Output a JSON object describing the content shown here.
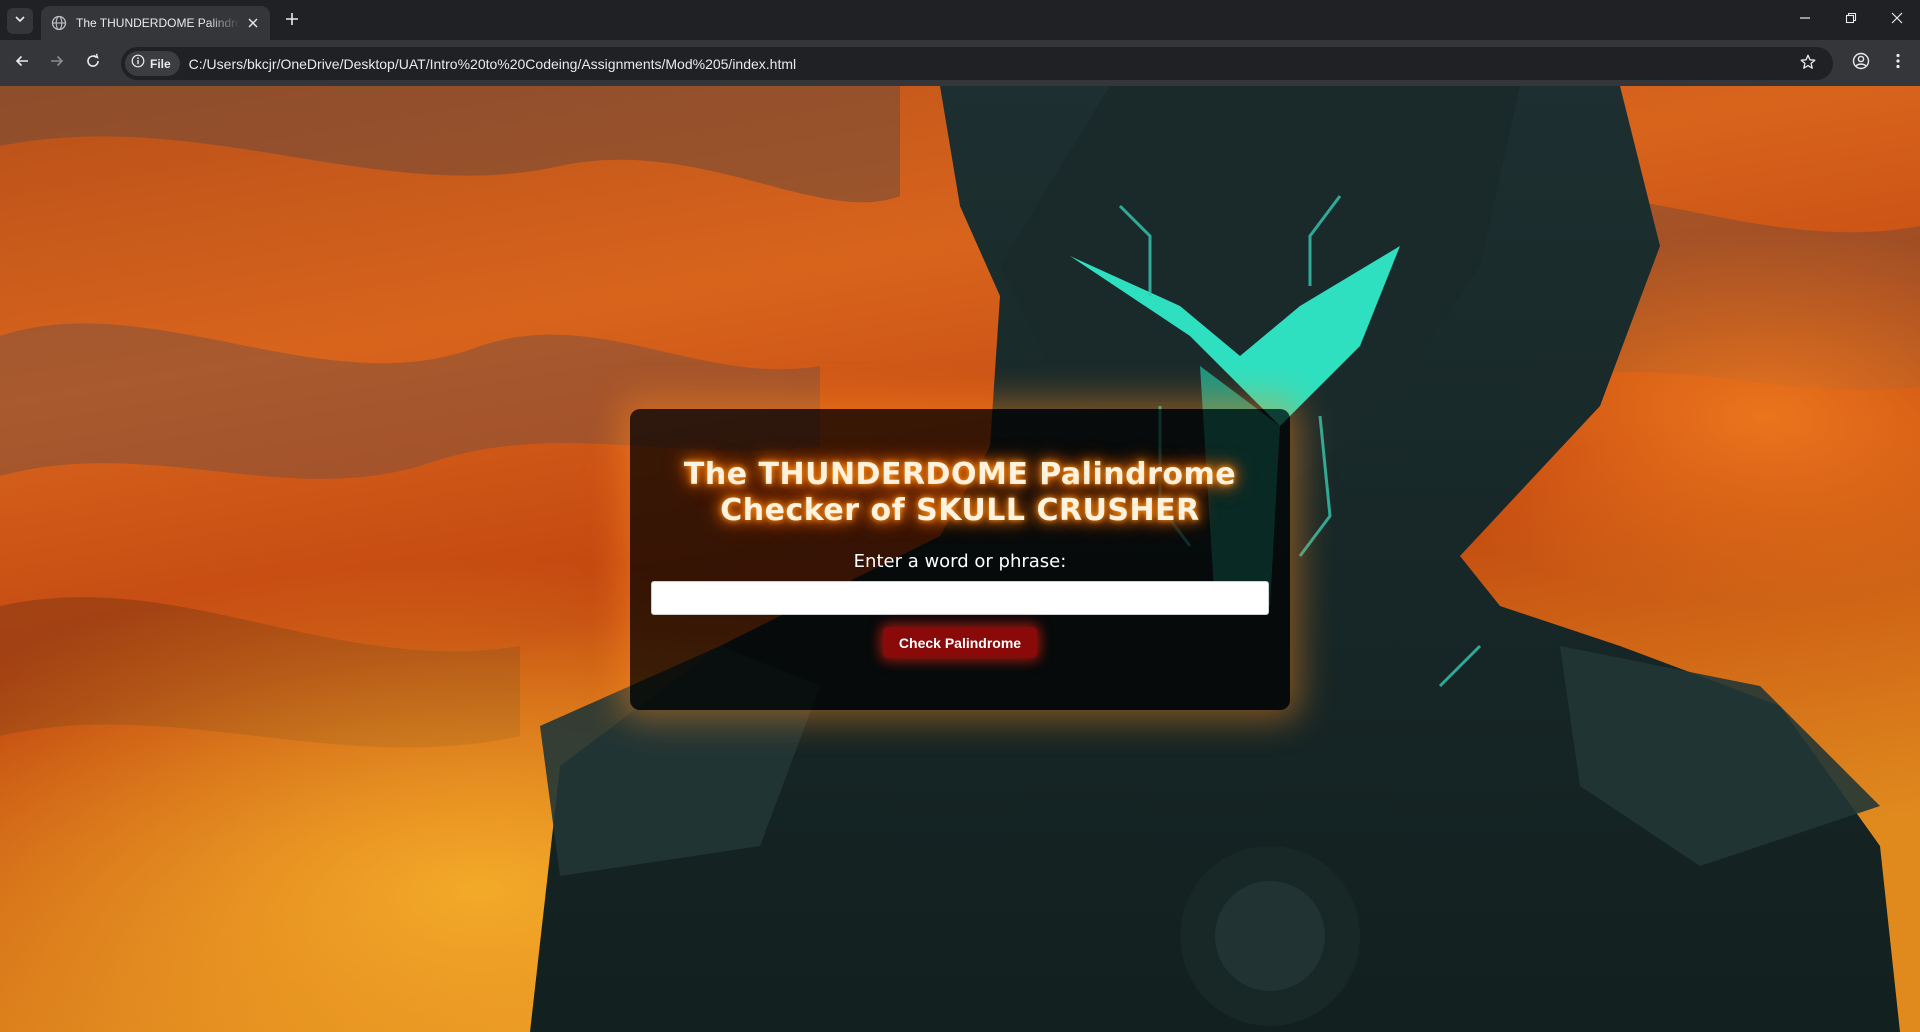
{
  "browser": {
    "tab_title": "The THUNDERDOME Palindrome Checker of SKULL CRUSHER",
    "site_chip_label": "File",
    "url": "C:/Users/bkcjr/OneDrive/Desktop/UAT/Intro%20to%20Codeing/Assignments/Mod%205/index.html",
    "icons": [
      "tab-search-icon",
      "globe-icon",
      "close-icon",
      "plus-icon",
      "minimize-icon",
      "restore-icon",
      "window-close-icon",
      "back-arrow-icon",
      "forward-arrow-icon",
      "reload-icon",
      "info-icon",
      "star-icon",
      "profile-icon",
      "kebab-menu-icon"
    ]
  },
  "page": {
    "title": "The THUNDERDOME Palindrome Checker of SKULL CRUSHER",
    "input_label": "Enter a word or phrase:",
    "input_value": "",
    "input_placeholder": "",
    "check_button_label": "Check Palindrome",
    "colors": {
      "panel_bg": "rgba(0,0,0,0.72)",
      "panel_glow": "#ff8c1e",
      "button_bg": "#8a0a0a",
      "title_glow": "#ff7a00"
    }
  }
}
